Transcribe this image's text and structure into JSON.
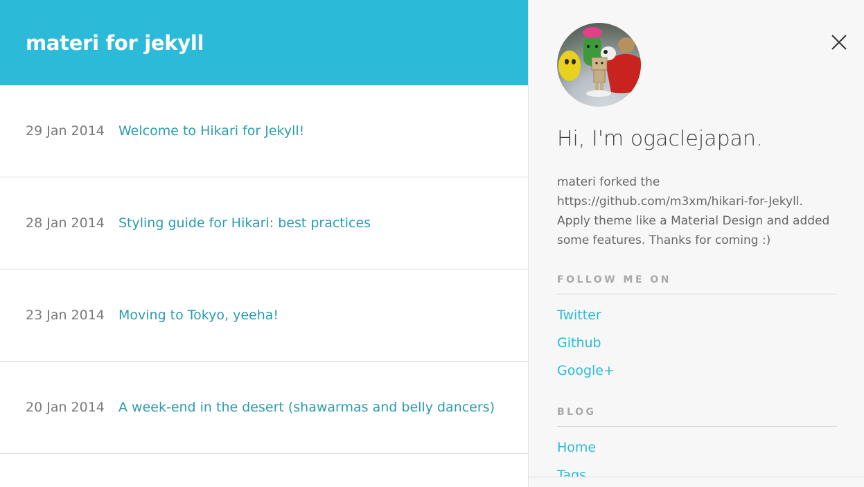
{
  "header": {
    "title": "materi for jekyll"
  },
  "posts": [
    {
      "date": "29 Jan 2014",
      "title": "Welcome to Hikari for Jekyll!"
    },
    {
      "date": "28 Jan 2014",
      "title": "Styling guide for Hikari: best practices"
    },
    {
      "date": "23 Jan 2014",
      "title": "Moving to Tokyo, yeeha!"
    },
    {
      "date": "20 Jan 2014",
      "title": "A week-end in the desert (shawarmas and belly dancers)"
    }
  ],
  "drawer": {
    "greeting": "Hi, I'm ogaclejapan.",
    "bio": "materi forked the https://github.com/m3xm/hikari-for-Jekyll. Apply theme like a Material Design and added some features. Thanks for coming :)",
    "follow_title": "FOLLOW ME ON",
    "follow_links": [
      "Twitter",
      "Github",
      "Google+"
    ],
    "blog_title": "BLOG",
    "blog_links": [
      "Home",
      "Tags"
    ],
    "close_icon": "close-icon",
    "avatar_icon": "avatar"
  },
  "colors": {
    "accent": "#2bbad8",
    "link": "#2a9bb0",
    "drawer_bg": "#f7f7f7"
  }
}
